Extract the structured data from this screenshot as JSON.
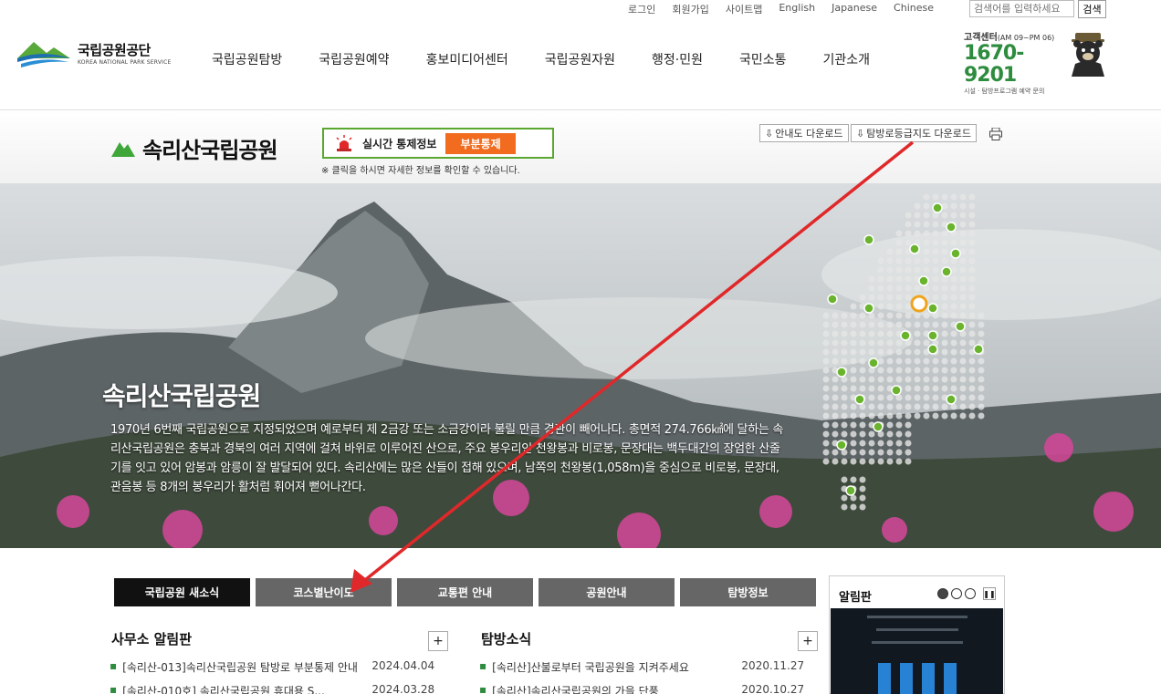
{
  "util": {
    "links": [
      "로그인",
      "회원가입",
      "사이트맵",
      "English",
      "Japanese",
      "Chinese"
    ],
    "search_placeholder": "검색어를 입력하세요",
    "search_button": "검색"
  },
  "header": {
    "logo_ko": "국립공원공단",
    "logo_en": "KOREA NATIONAL PARK SERVICE",
    "nav": [
      "국립공원탐방",
      "국립공원예약",
      "홍보미디어센터",
      "국립공원자원",
      "행정·민원",
      "국민소통",
      "기관소개"
    ],
    "cs_title": "고객센터",
    "cs_hours": "(AM 09~PM 06)",
    "cs_phone": "1670-9201",
    "cs_note": "시설 · 탐방프로그램 예약 문의"
  },
  "park": {
    "title": "속리산국립공원",
    "control_label": "실시간 통제정보",
    "control_status": "부분통제",
    "control_note": "※ 클릭을 하시면 자세한 정보를 확인할 수 있습니다.",
    "download_guide": "안내도 다운로드",
    "download_trail": "탐방로등급지도 다운로드"
  },
  "hero": {
    "title": "속리산국립공원",
    "desc": "1970년 6번째 국립공원으로 지정되었으며 예로부터 제 2금강 또는 소금강이라 불릴 만큼 경관이 빼어나다. 총면적 274.766㎢에 달하는 속리산국립공원은 충북과 경북의 여러 지역에 걸쳐 바위로 이루어진 산으로, 주요 봉우리인 천왕봉과 비로봉, 문장대는 백두대간의 장엄한 산줄기를 잇고 있어 암봉과 암릉이 잘 발달되어 있다. 속리산에는 많은 산들이 접해 있으며, 남쪽의 천왕봉(1,058m)을 중심으로 비로봉, 문장대, 관음봉 등 8개의 봉우리가 활처럼 휘어져 뻗어나간다."
  },
  "tabs": [
    "국립공원 새소식",
    "코스별난이도",
    "교통편 안내",
    "공원안내",
    "탐방정보"
  ],
  "boards": {
    "left_title": "사무소 알림판",
    "right_title": "탐방소식",
    "left_items": [
      {
        "text": "[속리산-013]속리산국립공원 탐방로 부분통제 안내",
        "date": "2024.04.04"
      },
      {
        "text": "[속리산-010호] 속리산국립공원 휴대용 S...",
        "date": "2024.03.28"
      }
    ],
    "right_items": [
      {
        "text": "[속리산]산불로부터 국립공원을 지켜주세요",
        "date": "2020.11.27"
      },
      {
        "text": "[속리산]속리산국립공원의 가을 단풍",
        "date": "2020.10.27"
      }
    ]
  },
  "notice": {
    "title": "알림판"
  },
  "colors": {
    "accent_green": "#5aa72f",
    "badge_orange": "#f26c1f",
    "arrow_red": "#e0282a",
    "tab_active": "#111111",
    "tab_inactive": "#666666"
  }
}
